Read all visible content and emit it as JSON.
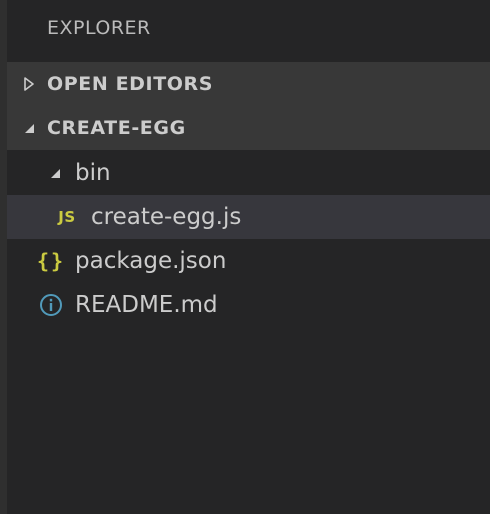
{
  "explorer": {
    "title": "EXPLORER"
  },
  "sections": {
    "open_editors": {
      "label": "OPEN EDITORS",
      "expanded": false
    },
    "project": {
      "label": "CREATE-EGG",
      "expanded": true
    }
  },
  "tree": {
    "folder_bin": {
      "label": "bin",
      "expanded": true
    },
    "file_create_egg": {
      "label": "create-egg.js",
      "icon": "JS",
      "selected": true
    },
    "file_package": {
      "label": "package.json",
      "icon": "{}"
    },
    "file_readme": {
      "label": "README.md",
      "icon": "info-icon"
    }
  },
  "colors": {
    "background": "#252526",
    "section_background": "#383838",
    "selected_background": "#37373d",
    "text": "#cccccc",
    "icon_yellow": "#cbcb41",
    "info_blue": "#519aba"
  }
}
